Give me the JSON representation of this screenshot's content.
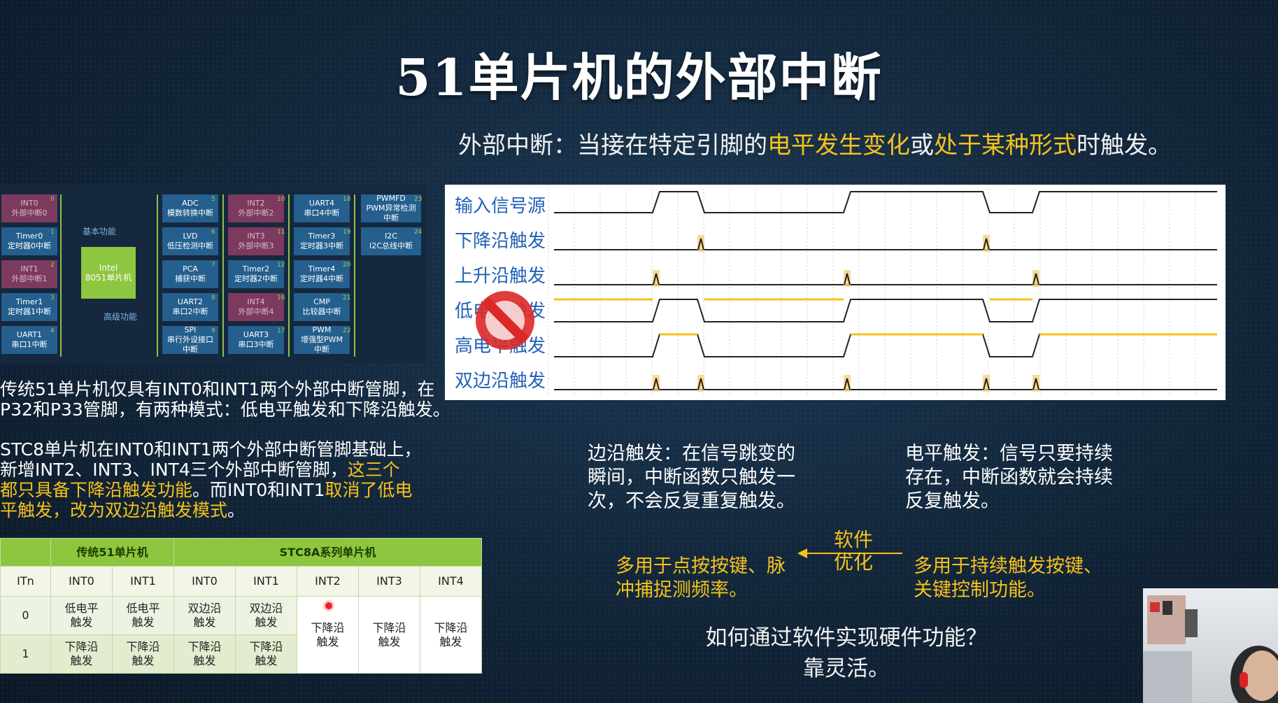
{
  "title": "51单片机的外部中断",
  "intro": {
    "p1": "外部中断：当接在特定引脚的",
    "h1": "电平发生变化",
    "p2": "或",
    "h2": "处于某种形式",
    "p3": "时触发。"
  },
  "diagram": {
    "center": "Intel\n8051单片机",
    "basic_label": "基本功能",
    "advanced_label": "高级功能",
    "left": [
      {
        "n": "0",
        "t": "INT0\n外部中断0",
        "hl": true
      },
      {
        "n": "1",
        "t": "Timer0\n定时器0中断",
        "hl": false
      },
      {
        "n": "2",
        "t": "INT1\n外部中断1",
        "hl": true
      },
      {
        "n": "3",
        "t": "Timer1\n定时器1中断",
        "hl": false
      },
      {
        "n": "4",
        "t": "UART1\n串口1中断",
        "hl": false
      }
    ],
    "col2": [
      {
        "n": "5",
        "t": "ADC\n模数转换中断"
      },
      {
        "n": "6",
        "t": "LVD\n低压检测中断"
      },
      {
        "n": "7",
        "t": "PCA\n捕获中断"
      },
      {
        "n": "8",
        "t": "UART2\n串口2中断"
      },
      {
        "n": "9",
        "t": "SPI\n串行外设接口\n中断"
      }
    ],
    "col3": [
      {
        "n": "10",
        "t": "INT2\n外部中断2",
        "hl": true
      },
      {
        "n": "11",
        "t": "INT3\n外部中断3",
        "hl": true
      },
      {
        "n": "12",
        "t": "Timer2\n定时器2中断",
        "hl": false
      },
      {
        "n": "16",
        "t": "INT4\n外部中断4",
        "hl": true
      },
      {
        "n": "17",
        "t": "UART3\n串口3中断",
        "hl": false
      }
    ],
    "col4": [
      {
        "n": "18",
        "t": "UART4\n串口4中断"
      },
      {
        "n": "19",
        "t": "Timer3\n定时器3中断"
      },
      {
        "n": "20",
        "t": "Timer4\n定时器4中断"
      },
      {
        "n": "21",
        "t": "CMP\n比较器中断"
      },
      {
        "n": "22",
        "t": "PWM\n增强型PWM\n中断"
      }
    ],
    "col5": [
      {
        "n": "23",
        "t": "PWMFD\nPWM异常检测\n中断"
      },
      {
        "n": "24",
        "t": "I2C\nI2C总线中断"
      }
    ]
  },
  "timing": {
    "labels": [
      "输入信号源",
      "下降沿触发",
      "上升沿触发",
      "低电平触发",
      "高电平触发",
      "双边沿触发"
    ]
  },
  "para1": "传统51单片机仅具有INT0和INT1两个外部中断管脚，在P32和P33管脚，有两种模式：低电平触发和下降沿触发。",
  "para1_l1": "传统51单片机仅具有INT0和INT1两个外部中断管脚，在",
  "para1_l2": "P32和P33管脚，有两种模式：低电平触发和下降沿触发。",
  "para2": {
    "l1": "STC8单片机在INT0和INT1两个外部中断管脚基础上，",
    "l2a": "新增INT2、INT3、INT4三个外部中断管脚，",
    "l2b": "这三个",
    "l3a": "都只具备下降沿触发功能",
    "l3b": "。而INT0和INT1",
    "l3c": "取消了低电",
    "l4a": "平触发，改为双边沿触发模式",
    "l4b": "。"
  },
  "edge": {
    "l1": "边沿触发：在信号跳变的",
    "l2": "瞬间，中断函数只触发一",
    "l3": "次，不会反复重复触发。"
  },
  "level": {
    "l1": "电平触发：信号只要持续",
    "l2": "存在，中断函数就会持续",
    "l3": "反复触发。"
  },
  "soft": {
    "l1": "软件",
    "l2": "优化"
  },
  "use_edge": {
    "l1": "多用于点按按键、脉",
    "l2": "冲捕捉测频率。"
  },
  "use_level": {
    "l1": "多用于持续触发按键、",
    "l2": "关键控制功能。"
  },
  "question": {
    "l1": "如何通过软件实现硬件功能？",
    "l2": "靠灵活。"
  },
  "table": {
    "h_trad": "传统51单片机",
    "h_stc": "STC8A系列单片机",
    "col_itn": "ITn",
    "cols": [
      "INT0",
      "INT1",
      "INT0",
      "INT1",
      "INT2",
      "INT3",
      "INT4"
    ],
    "r0": "0",
    "r1": "1",
    "trad0": [
      "低电平\n触发",
      "低电平\n触发"
    ],
    "trad1": [
      "下降沿\n触发",
      "下降沿\n触发"
    ],
    "stc0": [
      "双边沿\n触发",
      "双边沿\n触发"
    ],
    "stc1": [
      "下降沿\n触发",
      "下降沿\n触发"
    ],
    "stc_merged": [
      "下降沿\n触发",
      "下降沿\n触发",
      "下降沿\n触发"
    ]
  },
  "colors": {
    "accent": "#f6c21b",
    "timing_label": "#2261b8",
    "table_header": "#8ec63f"
  }
}
